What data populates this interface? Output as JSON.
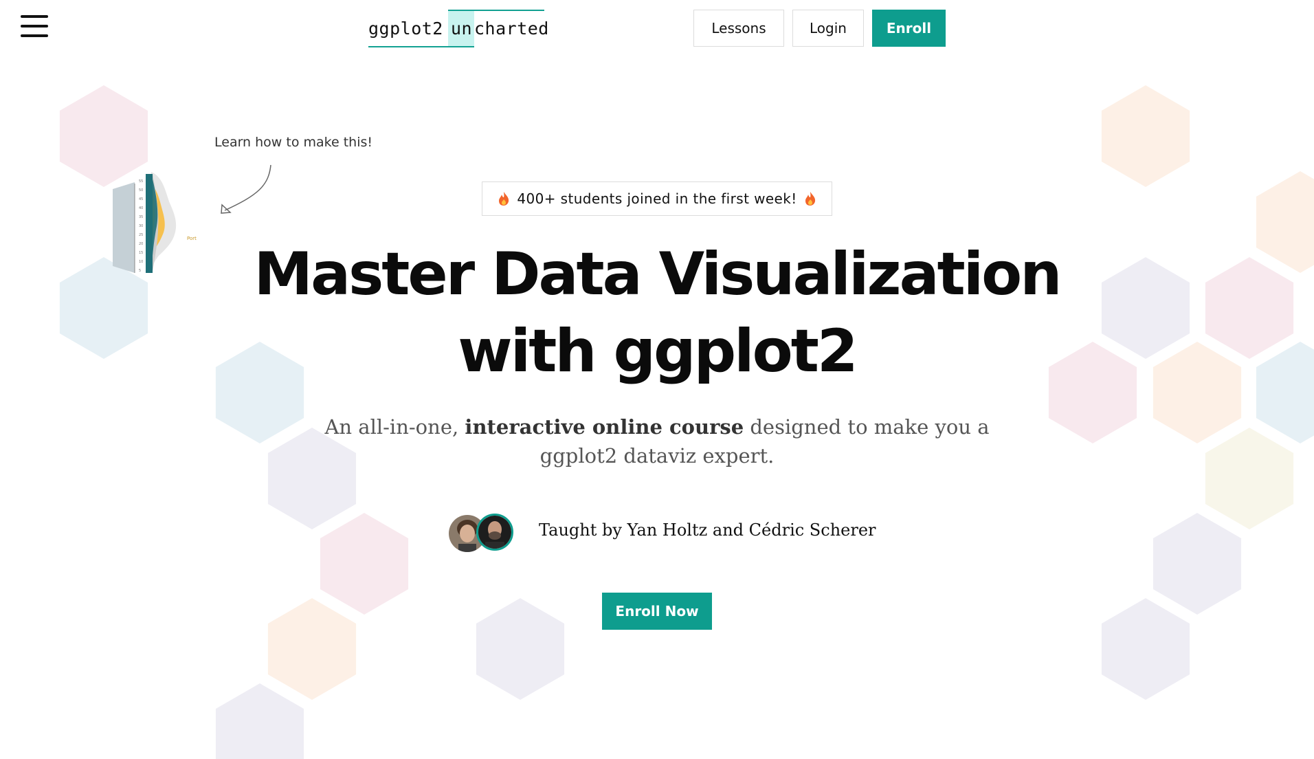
{
  "header": {
    "logo": {
      "part1": "ggplot2",
      "part2": "un",
      "part3": "charted"
    },
    "nav": {
      "lessons": "Lessons",
      "login": "Login",
      "enroll": "Enroll"
    },
    "menu_icon": "hamburger-menu-icon"
  },
  "hero": {
    "note": "Learn how to make this!",
    "badge": "400+ students joined in the first week!",
    "badge_icon": "fire-icon",
    "title_line1": "Master Data Visualization",
    "title_line2": "with ggplot2",
    "subtitle": {
      "pre": "An all-in-one, ",
      "bold": "interactive online course",
      "post": " designed to make you a ggplot2 dataviz expert."
    },
    "taught_by": "Taught by Yan Holtz and Cédric Scherer",
    "cta": "Enroll Now"
  },
  "colors": {
    "accent": "#0e9d8e",
    "logo_highlight": "#c8f3ef",
    "hex_pink": "#f8e9ee",
    "hex_blue": "#e6f0f5",
    "hex_lavender": "#eeedf4",
    "hex_peach": "#fdf0e6",
    "hex_cream": "#f8f6ea"
  }
}
